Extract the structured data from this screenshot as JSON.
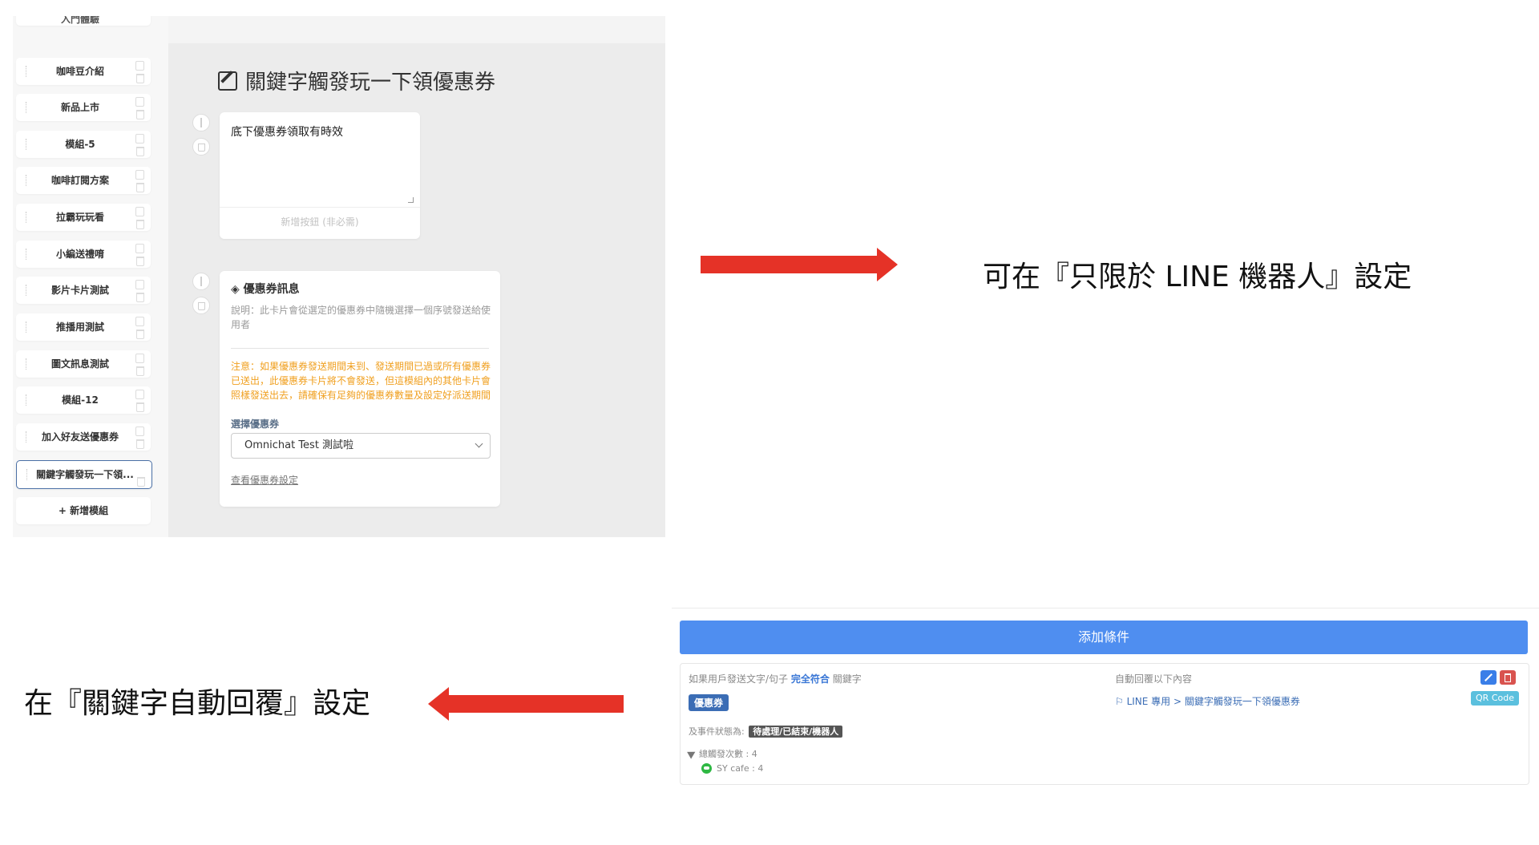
{
  "sidebar": {
    "partial_item": "入門體驗",
    "items": [
      {
        "label": "咖啡豆介紹"
      },
      {
        "label": "新品上市"
      },
      {
        "label": "模組-5"
      },
      {
        "label": "咖啡訂閱方案"
      },
      {
        "label": "拉霸玩玩看"
      },
      {
        "label": "小編送禮唷"
      },
      {
        "label": "影片卡片測試"
      },
      {
        "label": "推播用測試"
      },
      {
        "label": "圖文訊息測試"
      },
      {
        "label": "模組-12"
      },
      {
        "label": "加入好友送優惠券"
      },
      {
        "label": "關鍵字觸發玩一下領..."
      }
    ],
    "add_module": "+ 新增模組"
  },
  "editor": {
    "title": "關鍵字觸發玩一下領優惠券",
    "text_card": {
      "text": "底下優惠券領取有時效",
      "add_button": "新增按鈕 (非必需)"
    },
    "coupon_card": {
      "heading": "優惠券訊息",
      "description": "說明：此卡片會從選定的優惠券中隨機選擇一個序號發送給使用者",
      "warning": "注意：如果優惠券發送期間未到、發送期間已過或所有優惠券已送出，此優惠券卡片將不會發送，但這模組內的其他卡片會照樣發送出去，請確保有足夠的優惠券數量及設定好派送期間",
      "select_label": "選擇優惠券",
      "selected": "Omnichat Test 測試啦",
      "settings_link": "查看優惠券設定"
    }
  },
  "captions": {
    "right": "可在『只限於 LINE 機器人』設定",
    "left": "在『關鍵字自動回覆』設定"
  },
  "colors": {
    "arrow": "#e53227",
    "primary": "#4f8ef0",
    "warning": "#f0a020"
  },
  "rules": {
    "add_condition": "添加條件",
    "condition_prefix": "如果用戶發送文字/句子",
    "condition_match": "完全符合",
    "condition_suffix": "關鍵字",
    "keyword": "優惠券",
    "status_label": "及事件狀態為:",
    "status_tag": "待處理/已結束/機器人",
    "total_triggers": "總觸發次數 : 4",
    "channel": "SY cafe : 4",
    "reply_label": "自動回覆以下內容",
    "reply_path": "LINE 專用 > 關鍵字觸發玩一下領優惠券",
    "qr_code": "QR Code"
  }
}
